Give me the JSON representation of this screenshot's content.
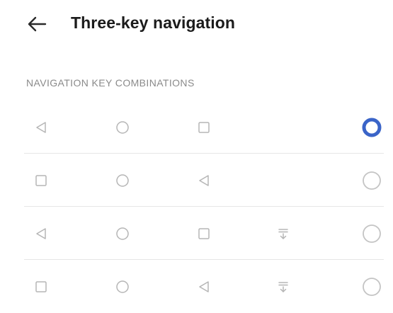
{
  "header": {
    "title": "Three-key navigation",
    "back_icon": "arrow-left-icon"
  },
  "section": {
    "label": "NAVIGATION KEY COMBINATIONS"
  },
  "colors": {
    "accent": "#3a64c8",
    "key_stroke": "#b5b5b5",
    "radio_unselected": "#c4c4c4"
  },
  "combinations": [
    {
      "keys": [
        "back",
        "home",
        "recents"
      ],
      "selected": true
    },
    {
      "keys": [
        "recents",
        "home",
        "back"
      ],
      "selected": false
    },
    {
      "keys": [
        "back",
        "home",
        "recents",
        "notification"
      ],
      "selected": false
    },
    {
      "keys": [
        "recents",
        "home",
        "back",
        "notification"
      ],
      "selected": false
    }
  ]
}
